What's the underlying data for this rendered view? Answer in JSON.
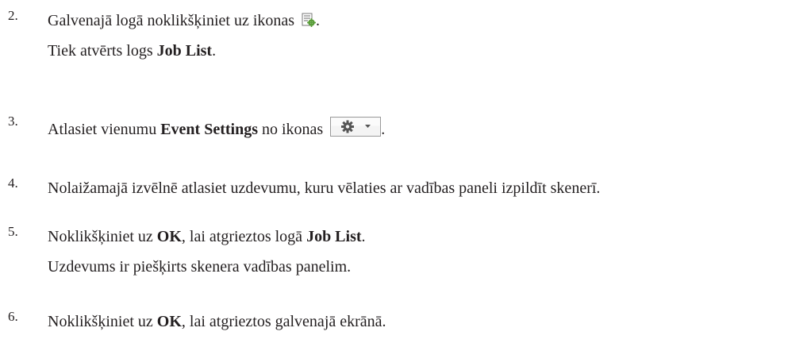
{
  "steps": [
    {
      "number": "2.",
      "lines": [
        {
          "parts": [
            "Galvenajā logā noklikšķiniet uz ikonas ",
            "."
          ]
        },
        {
          "pre": "Tiek atvērts logs ",
          "bold": "Job List",
          "post": "."
        }
      ],
      "icon": "job-list-icon"
    },
    {
      "number": "3.",
      "pre": "Atlasiet vienumu ",
      "bold": "Event Settings",
      "mid": " no ikonas ",
      "post": ".",
      "icon": "gear-dropdown-icon"
    },
    {
      "number": "4.",
      "text": "Nolaižamajā izvēlnē atlasiet uzdevumu, kuru vēlaties ar vadības paneli izpildīt skenerī."
    },
    {
      "number": "5.",
      "pre": "Noklikšķiniet uz ",
      "bold1": "OK",
      "mid": ", lai atgrieztos logā ",
      "bold2": "Job List",
      "post": ".",
      "line2": "Uzdevums ir piešķirts skenera vadības panelim."
    },
    {
      "number": "6.",
      "pre": "Noklikšķiniet uz ",
      "bold": "OK",
      "post": ", lai atgrieztos galvenajā ekrānā."
    }
  ],
  "colors": {
    "text": "#231f20",
    "icon_green": "#5a9e3a",
    "button_border": "#9a9a9a"
  }
}
